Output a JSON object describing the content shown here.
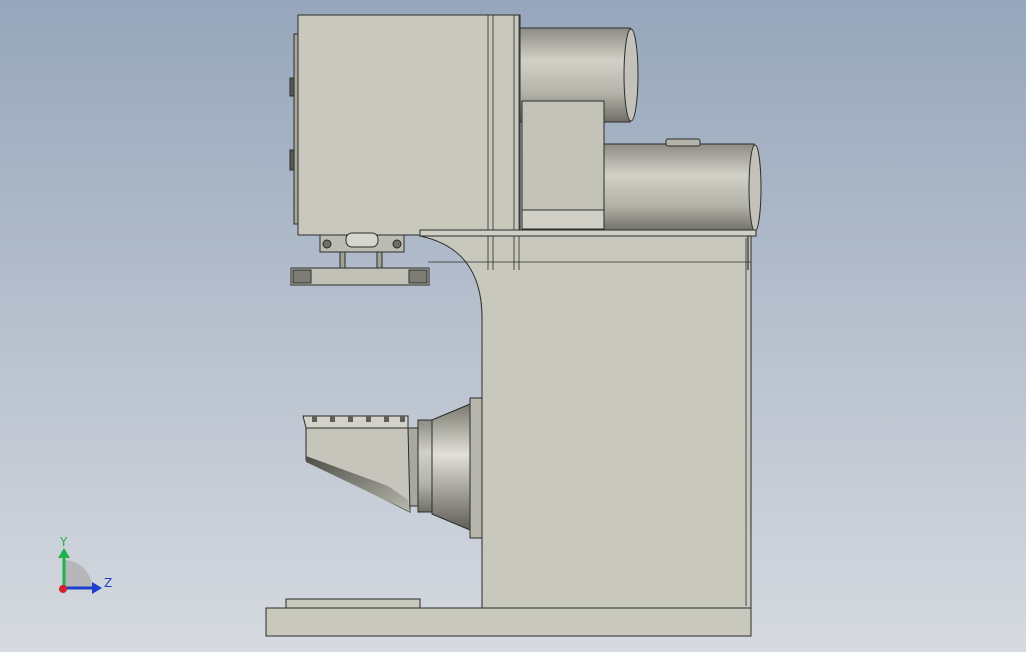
{
  "viewport": {
    "background_top": "#97a6bb",
    "background_bottom": "#d6dae0",
    "part_fill": "#c9c8bc",
    "part_stroke": "#2b2b2b"
  },
  "triad": {
    "y_label": "Y",
    "z_label": "Z",
    "y_color": "#22b04a",
    "z_color": "#1e3fcc",
    "x_color": "#d2232a"
  }
}
